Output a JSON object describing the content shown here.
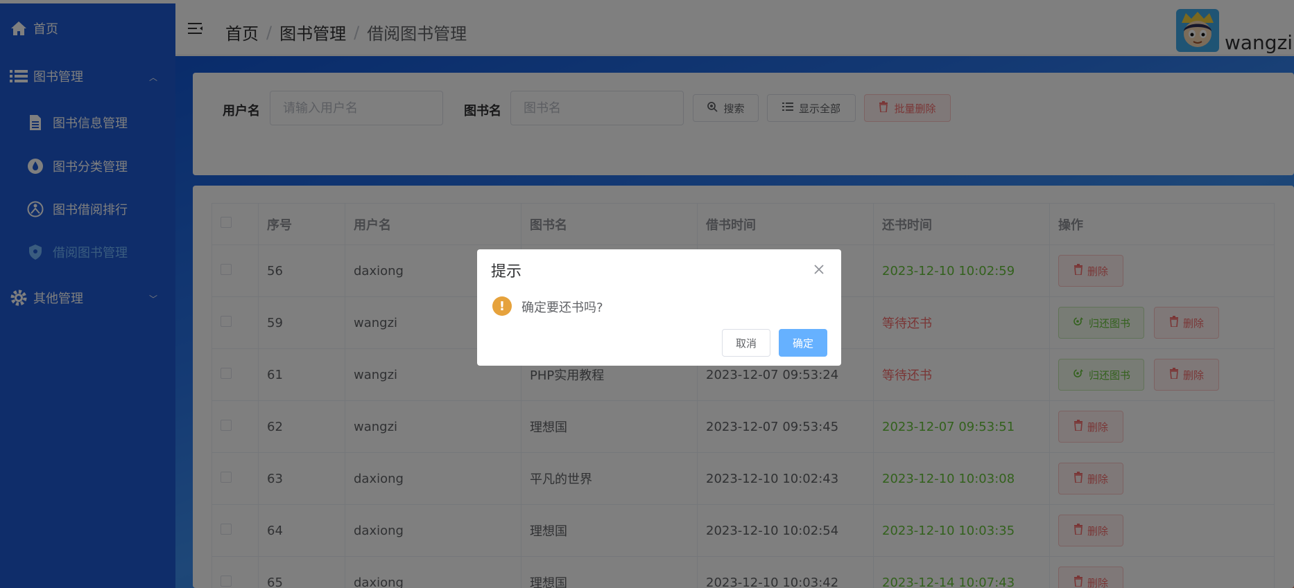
{
  "sidebar": {
    "items": [
      {
        "label": "首页",
        "icon": "home-icon"
      },
      {
        "label": "图书管理",
        "icon": "list-icon"
      },
      {
        "label": "图书信息管理",
        "icon": "document-icon"
      },
      {
        "label": "图书分类管理",
        "icon": "drop-icon"
      },
      {
        "label": "图书借阅排行",
        "icon": "chart-icon"
      },
      {
        "label": "借阅图书管理",
        "icon": "shield-icon"
      },
      {
        "label": "其他管理",
        "icon": "gear-icon"
      }
    ]
  },
  "header": {
    "breadcrumb": [
      "首页",
      "图书管理",
      "借阅图书管理"
    ],
    "separator": "/",
    "username": "wangzi"
  },
  "search": {
    "user_label": "用户名",
    "user_placeholder": "请输入用户名",
    "book_label": "图书名",
    "book_placeholder": "图书名",
    "search_btn": "搜索",
    "show_all_btn": "显示全部",
    "batch_delete_btn": "批量删除"
  },
  "table": {
    "columns": [
      "序号",
      "用户名",
      "图书名",
      "借书时间",
      "还书时间",
      "操作"
    ],
    "rows": [
      {
        "id": "56",
        "user": "daxiong",
        "book": "",
        "borrow": "",
        "return": "2023-12-10 10:02:59",
        "status": "green",
        "can_return": false
      },
      {
        "id": "59",
        "user": "wangzi",
        "book": "",
        "borrow": "",
        "return": "等待还书",
        "status": "red",
        "can_return": true
      },
      {
        "id": "61",
        "user": "wangzi",
        "book": "PHP实用教程",
        "borrow": "2023-12-07 09:53:24",
        "return": "等待还书",
        "status": "red",
        "can_return": true
      },
      {
        "id": "62",
        "user": "wangzi",
        "book": "理想国",
        "borrow": "2023-12-07 09:53:45",
        "return": "2023-12-07 09:53:51",
        "status": "green",
        "can_return": false
      },
      {
        "id": "63",
        "user": "daxiong",
        "book": "平凡的世界",
        "borrow": "2023-12-10 10:02:43",
        "return": "2023-12-10 10:03:08",
        "status": "green",
        "can_return": false
      },
      {
        "id": "64",
        "user": "daxiong",
        "book": "理想国",
        "borrow": "2023-12-10 10:02:54",
        "return": "2023-12-10 10:03:35",
        "status": "green",
        "can_return": false
      },
      {
        "id": "65",
        "user": "daxiong",
        "book": "理想国",
        "borrow": "2023-12-10 10:03:42",
        "return": "2023-12-14 10:07:43",
        "status": "green",
        "can_return": false
      }
    ],
    "delete_label": "删除",
    "return_label": "归还图书"
  },
  "dialog": {
    "title": "提示",
    "message": "确定要还书吗?",
    "cancel": "取消",
    "confirm": "确定"
  },
  "colors": {
    "sidebar": "#1f5bd4",
    "primary": "#66b1ff",
    "danger": "#f56c6c",
    "success": "#67c23a",
    "warning": "#e6a23c"
  }
}
